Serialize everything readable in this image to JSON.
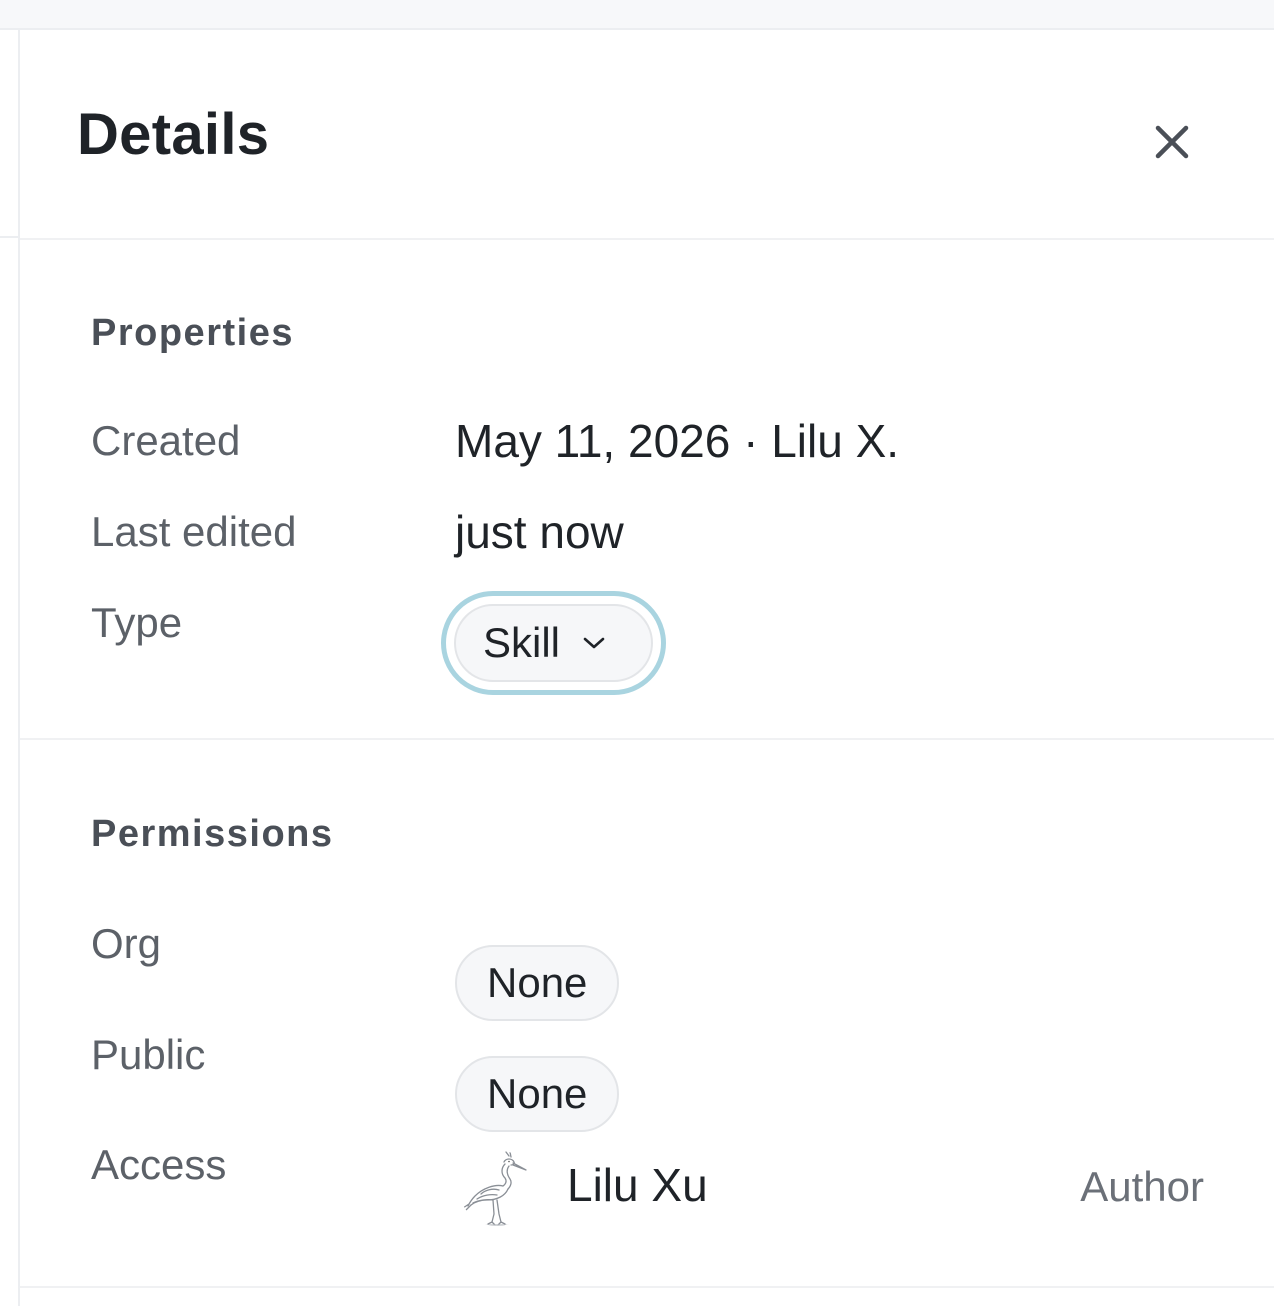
{
  "panel": {
    "title": "Details",
    "close_icon": "close-icon"
  },
  "properties": {
    "title": "Properties",
    "created": {
      "label": "Created",
      "value": "May 11, 2026 · Lilu X."
    },
    "last_edited": {
      "label": "Last edited",
      "value": "just now"
    },
    "type": {
      "label": "Type",
      "value": "Skill",
      "icon": "chevron-down-icon",
      "focus_ring_color": "#a9d4e0"
    }
  },
  "permissions": {
    "title": "Permissions",
    "org": {
      "label": "Org",
      "value": "None"
    },
    "public": {
      "label": "Public",
      "value": "None"
    },
    "access": {
      "label": "Access",
      "avatar_icon": "heron-avatar-icon",
      "name": "Lilu Xu",
      "role": "Author"
    }
  }
}
